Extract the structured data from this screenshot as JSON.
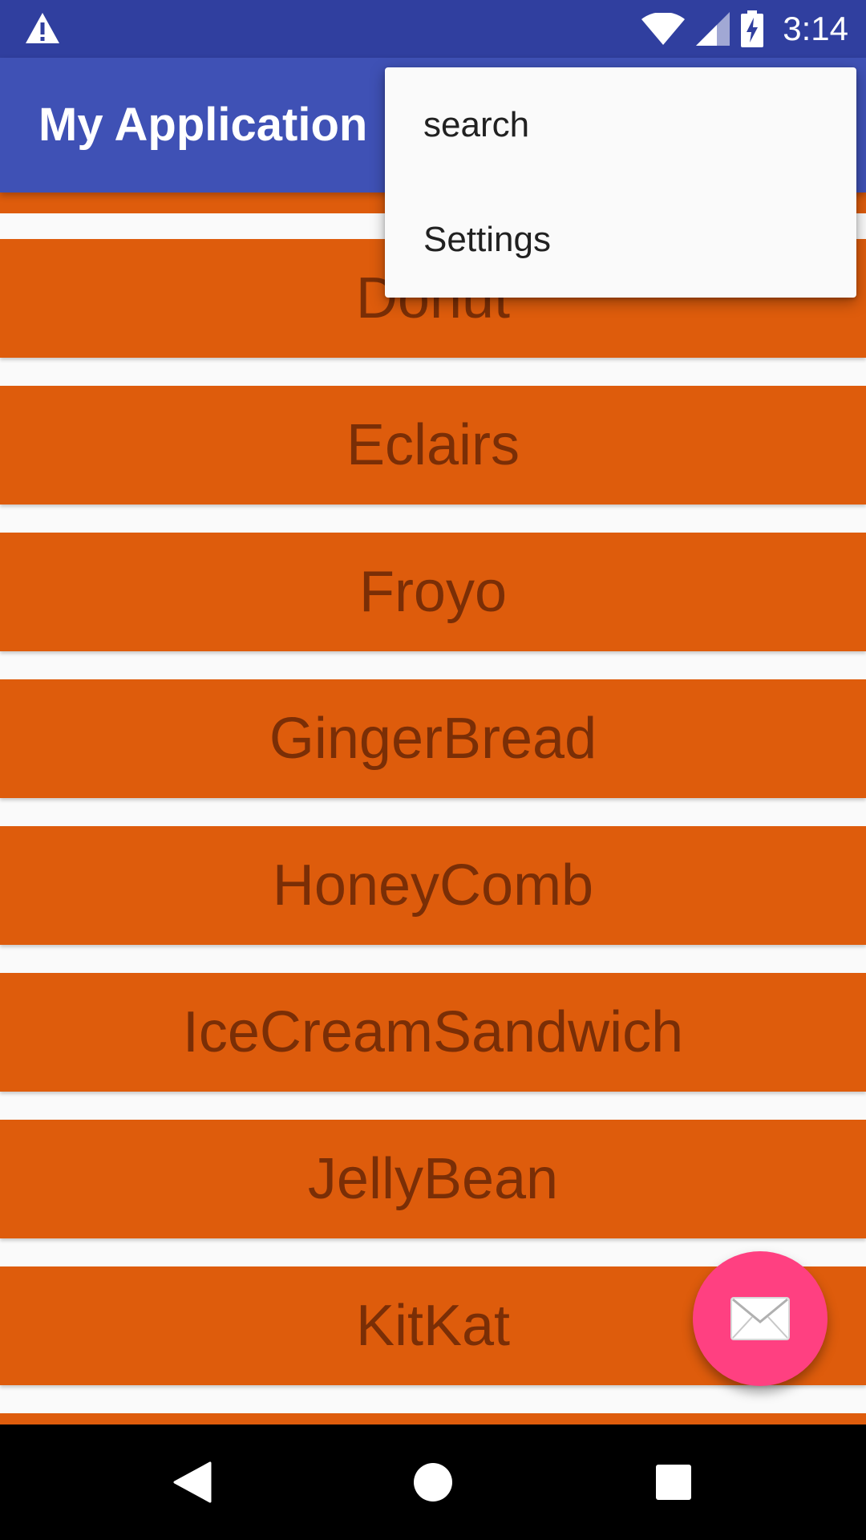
{
  "status_bar": {
    "time": "3:14",
    "icons": [
      "warning-icon",
      "wifi-icon",
      "cell-signal-icon",
      "battery-charging-icon"
    ],
    "color": "#303f9f"
  },
  "app_bar": {
    "title": "My Application",
    "color": "#3f51b5"
  },
  "overflow_menu": {
    "items": [
      {
        "label": "search"
      },
      {
        "label": "Settings"
      }
    ]
  },
  "list": {
    "item_color": "#de5c0c",
    "text_color": "#7a2e06",
    "items": [
      {
        "label": "Donut"
      },
      {
        "label": "Eclairs"
      },
      {
        "label": "Froyo"
      },
      {
        "label": "GingerBread"
      },
      {
        "label": "HoneyComb"
      },
      {
        "label": "IceCreamSandwich"
      },
      {
        "label": "JellyBean"
      },
      {
        "label": "KitKat"
      }
    ]
  },
  "fab": {
    "icon": "mail-icon",
    "color": "#ff4081"
  },
  "nav_bar": {
    "buttons": [
      "back-icon",
      "home-icon",
      "recents-icon"
    ]
  }
}
